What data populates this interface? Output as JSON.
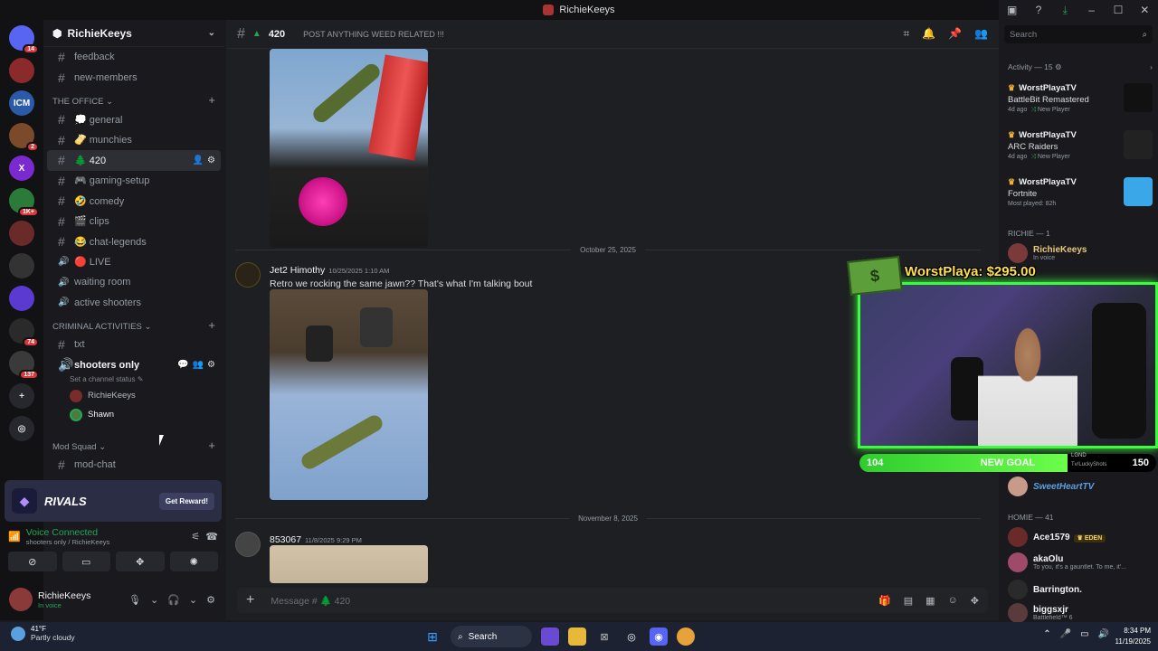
{
  "window": {
    "title": "RichieKeeys"
  },
  "servers": [
    {
      "label": "",
      "badge": "14",
      "color": "#5865f2"
    },
    {
      "label": "",
      "badge": "",
      "color": "#8b2a2a"
    },
    {
      "label": "ICM",
      "badge": "",
      "color": "#2a5aa8"
    },
    {
      "label": "",
      "badge": "2",
      "color": "#7a4a2a"
    },
    {
      "label": "X",
      "badge": "",
      "color": "#7a2ad0"
    },
    {
      "label": "",
      "badge": "1K+",
      "color": "#2a7a3a"
    },
    {
      "label": "",
      "badge": "",
      "color": "#6a2a2a"
    },
    {
      "label": "",
      "badge": "",
      "color": "#333333"
    },
    {
      "label": "",
      "badge": "",
      "color": "#5a3ad0"
    },
    {
      "label": "",
      "badge": "74",
      "color": "#2a2a2a"
    },
    {
      "label": "",
      "badge": "137",
      "color": "#3a3a3a"
    }
  ],
  "server": {
    "name": "RichieKeeys"
  },
  "channels_top": [
    {
      "name": "feedback"
    },
    {
      "name": "new-members"
    }
  ],
  "cat_office": "THE OFFICE",
  "office_channels": [
    {
      "name": "💭 general",
      "icon": "#"
    },
    {
      "name": "🫔 munchies",
      "icon": "#"
    },
    {
      "name": "🌲 420",
      "icon": "#",
      "active": true
    },
    {
      "name": "🎮 gaming-setup",
      "icon": "#"
    },
    {
      "name": "🤣 comedy",
      "icon": "#"
    },
    {
      "name": "🎬 clips",
      "icon": "#"
    },
    {
      "name": "😂 chat-legends",
      "icon": "#"
    },
    {
      "name": "🔴 LIVE",
      "icon": "voice"
    },
    {
      "name": "waiting room",
      "icon": "voice"
    },
    {
      "name": "active shooters",
      "icon": "voice"
    }
  ],
  "cat_criminal": "CRIMINAL ACTIVITIES",
  "criminal": {
    "txt": "txt",
    "voice": "shooters only",
    "status": "Set a channel status",
    "users": [
      "RichieKeeys",
      "Shawn"
    ]
  },
  "cat_mod": "Mod Squad",
  "mod_channel": "mod-chat",
  "promo": {
    "name": "RIVALS",
    "button": "Get Reward!"
  },
  "voice": {
    "connected": "Voice Connected",
    "where": "shooters only / RichieKeeys"
  },
  "user": {
    "name": "RichieKeeys",
    "status": "In voice"
  },
  "channel": {
    "name": "420",
    "topic": "POST ANYTHING WEED RELATED !!!"
  },
  "dates": [
    "October 25, 2025",
    "November 8, 2025"
  ],
  "messages": [
    {
      "author": "Jet2 Himothy",
      "time": "10/25/2025 1:10 AM",
      "text": "Retro we rocking the same jawn?? That's what I'm talking bout"
    },
    {
      "author": "853067",
      "time": "11/8/2025 9:29 PM",
      "text": ""
    }
  ],
  "composer": {
    "placeholder": "Message # 🌲 420"
  },
  "overlay": {
    "goal_title": "WorstPlaya: $295.00",
    "start": "104",
    "label": "NEW GOAL",
    "target": "150",
    "progress": 0.3,
    "lgnd": "LGND",
    "url": "Tv/LuckyShots"
  },
  "right": {
    "search_placeholder": "Search",
    "activity_header": "Activity — 15",
    "activities": [
      {
        "user": "WorstPlayaTV",
        "game": "BattleBit Remastered",
        "meta1": "4d ago",
        "meta2": "New Player",
        "thumb": "#111111"
      },
      {
        "user": "WorstPlayaTV",
        "game": "ARC Raiders",
        "meta1": "4d ago",
        "meta2": "New Player",
        "thumb": "#222222"
      },
      {
        "user": "WorstPlayaTV",
        "game": "Fortnite",
        "meta1": "Most played: 82h",
        "meta2": "",
        "thumb": "#3aa8e8"
      }
    ],
    "richie_header": "RICHIE — 1",
    "richie_member": {
      "name": "RichieKeeys",
      "sub": "In voice"
    },
    "sweetheart": "SweetHeartTV",
    "homie_header": "HOMIE — 41",
    "homies": [
      {
        "name": "Ace1579",
        "sub": "",
        "tag": "EDEN"
      },
      {
        "name": "akaOlu",
        "sub": "To you, it's a gauntlet. To me, it'...",
        "tag": ""
      },
      {
        "name": "Barrington.",
        "sub": "",
        "tag": ""
      },
      {
        "name": "biggsxjr",
        "sub": "Battlefield™ 6",
        "tag": ""
      }
    ]
  },
  "taskbar": {
    "temp": "41°F",
    "weather": "Partly cloudy",
    "search": "Search",
    "time": "8:34 PM",
    "date": "11/19/2025"
  }
}
